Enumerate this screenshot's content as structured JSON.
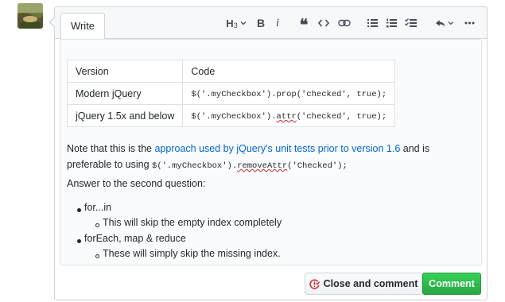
{
  "header": {
    "write_tab": "Write"
  },
  "toolbar": {
    "heading_label": "H",
    "heading_sub": "3",
    "bold_label": "B",
    "italic_label": "i",
    "quote_label": "❝",
    "icons": [
      "heading-icon",
      "bold-icon",
      "italic-icon",
      "quote-icon",
      "code-icon",
      "link-icon",
      "bulleted-list-icon",
      "numbered-list-icon",
      "task-list-icon",
      "reply-icon",
      "more-icon"
    ]
  },
  "editor": {
    "table": {
      "headers": [
        "Version",
        "Code"
      ],
      "rows": [
        {
          "version": "Modern jQuery",
          "code": "$('.myCheckbox').prop('checked', true);"
        },
        {
          "version": "jQuery 1.5x and below",
          "code_pre": "$('.myCheckbox').",
          "code_squig": "attr",
          "code_post": "('checked', true);"
        }
      ]
    },
    "para1": {
      "text_a": "Note that this is the ",
      "link": "approach used by jQuery's unit tests prior to version 1.6",
      "text_b": " and is preferable to using ",
      "code_pre": "$('.myCheckbox').",
      "code_squig": "removeAttr",
      "code_post": "('Checked');"
    },
    "para2": "Answer to the second question:",
    "list": [
      {
        "label": "for...in",
        "sub": "This will skip the empty index completely"
      },
      {
        "label": "forEach, map & reduce",
        "sub": "These will simply skip the missing index."
      }
    ]
  },
  "actions": {
    "close_label": "Close and comment",
    "comment_label": "Comment"
  },
  "colors": {
    "link": "#0366d6",
    "comment_button": "#28a745",
    "close_icon": "#cb2431"
  }
}
